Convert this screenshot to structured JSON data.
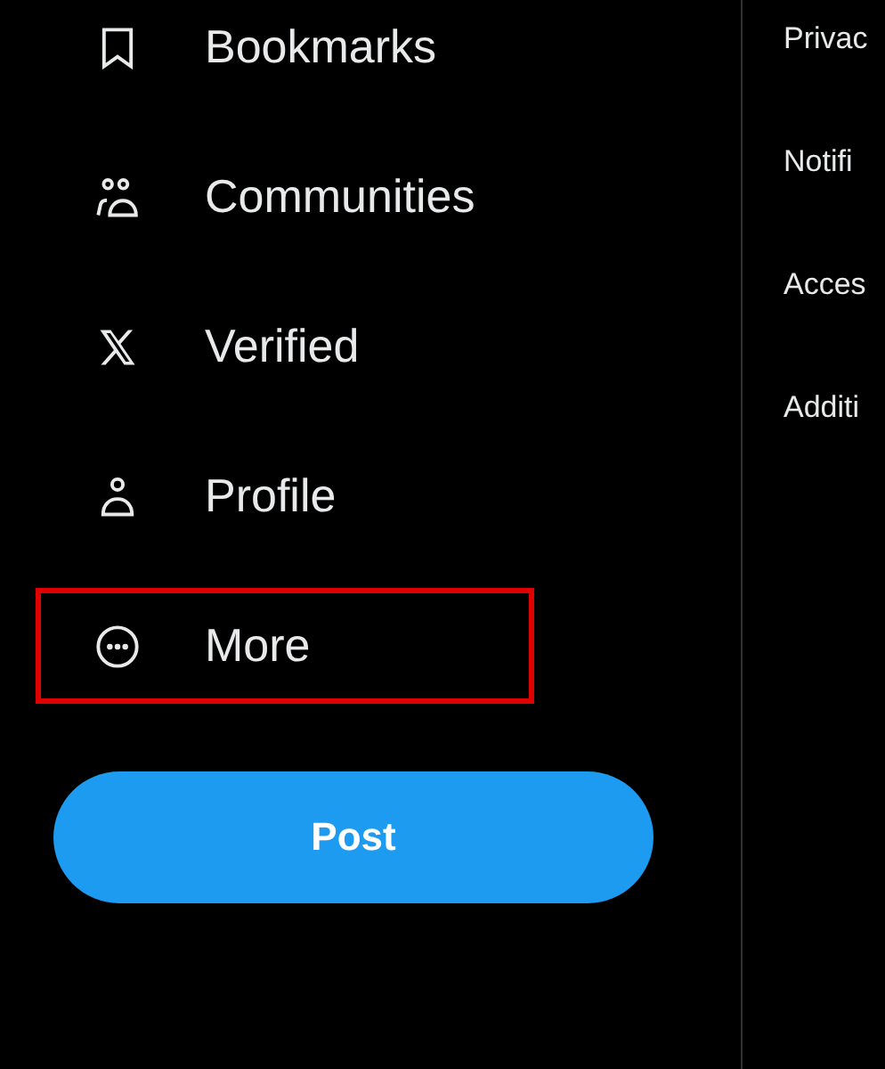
{
  "nav_items": [
    {
      "kind": "bookmark",
      "label": "Bookmarks",
      "highlighted": false
    },
    {
      "kind": "people",
      "label": "Communities",
      "highlighted": false
    },
    {
      "kind": "x",
      "label": "Verified",
      "highlighted": false
    },
    {
      "kind": "person",
      "label": "Profile",
      "highlighted": false
    },
    {
      "kind": "more",
      "label": "More",
      "highlighted": true
    }
  ],
  "post_button": {
    "label": "Post"
  },
  "settings_items": [
    "Privac",
    "Notifi",
    "Acces",
    "Additi"
  ]
}
